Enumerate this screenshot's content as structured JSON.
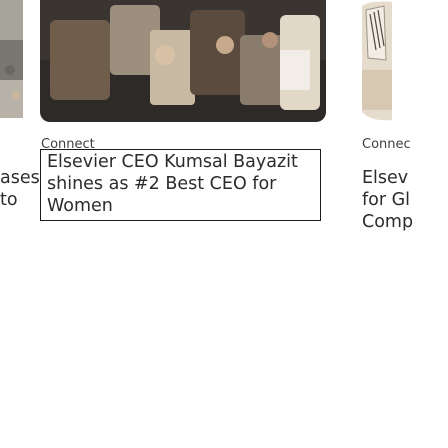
{
  "cards": [
    {
      "category": "",
      "title_lines": [
        "ases",
        "to"
      ]
    },
    {
      "category": "Connect",
      "title_lines": [
        "Elsevier CEO Kumsal Bayazit",
        "shines as #2 Best CEO for",
        "Women"
      ]
    },
    {
      "category": "Connec",
      "title_lines": [
        "Elsev",
        "for Gl",
        "Comp"
      ]
    }
  ],
  "colors": {
    "text": "#2c2c2c",
    "category_text": "#3f3f3f",
    "focus_outline": "#1a1a1a"
  }
}
